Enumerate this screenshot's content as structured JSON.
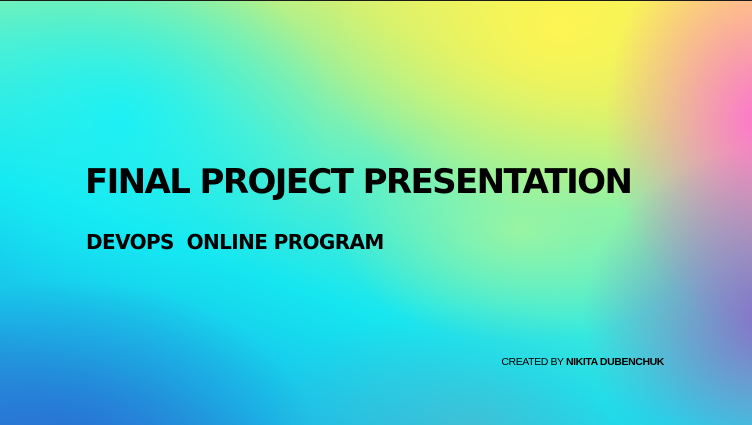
{
  "slide": {
    "title": "FINAL PROJECT PRESENTATION",
    "subtitle": "DEVOPS  ONLINE PROGRAM",
    "credit": {
      "prefix": "CREATED BY ",
      "name": "NIKITA DUBENCHUK"
    }
  }
}
